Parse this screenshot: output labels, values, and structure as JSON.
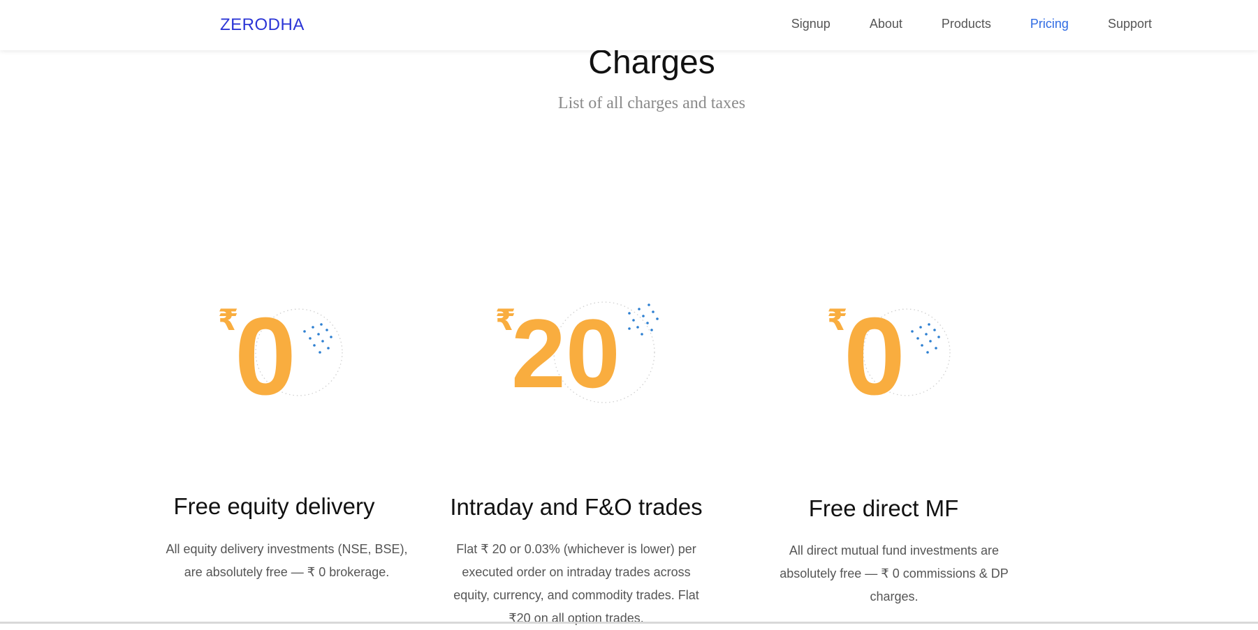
{
  "nav": {
    "brand": "ZERODHA",
    "links": [
      "Signup",
      "About",
      "Products",
      "Pricing",
      "Support"
    ],
    "active": "Pricing"
  },
  "hero": {
    "title": "Charges",
    "subtitle": "List of all charges and taxes"
  },
  "cards": [
    {
      "symbol": "₹",
      "amount": "0",
      "title": "Free equity delivery",
      "description": "All equity delivery investments (NSE, BSE), are absolutely free — ₹ 0 brokerage."
    },
    {
      "symbol": "₹",
      "amount": "20",
      "title": "Intraday and F&O trades",
      "description": "Flat ₹ 20 or 0.03% (whichever is lower) per executed order on intraday trades across equity, currency, and commodity trades. Flat ₹20 on all option trades."
    },
    {
      "symbol": "₹",
      "amount": "0",
      "title": "Free direct MF",
      "description": "All direct mutual fund investments are absolutely free — ₹ 0 commissions & DP charges."
    }
  ],
  "colors": {
    "brand": "#2b35d6",
    "active_link": "#2f6be3",
    "figure": "#f9ad3f",
    "dots": "#2d7fd1"
  },
  "icons": [
    "rupee-icon",
    "dot-pattern-icon"
  ]
}
